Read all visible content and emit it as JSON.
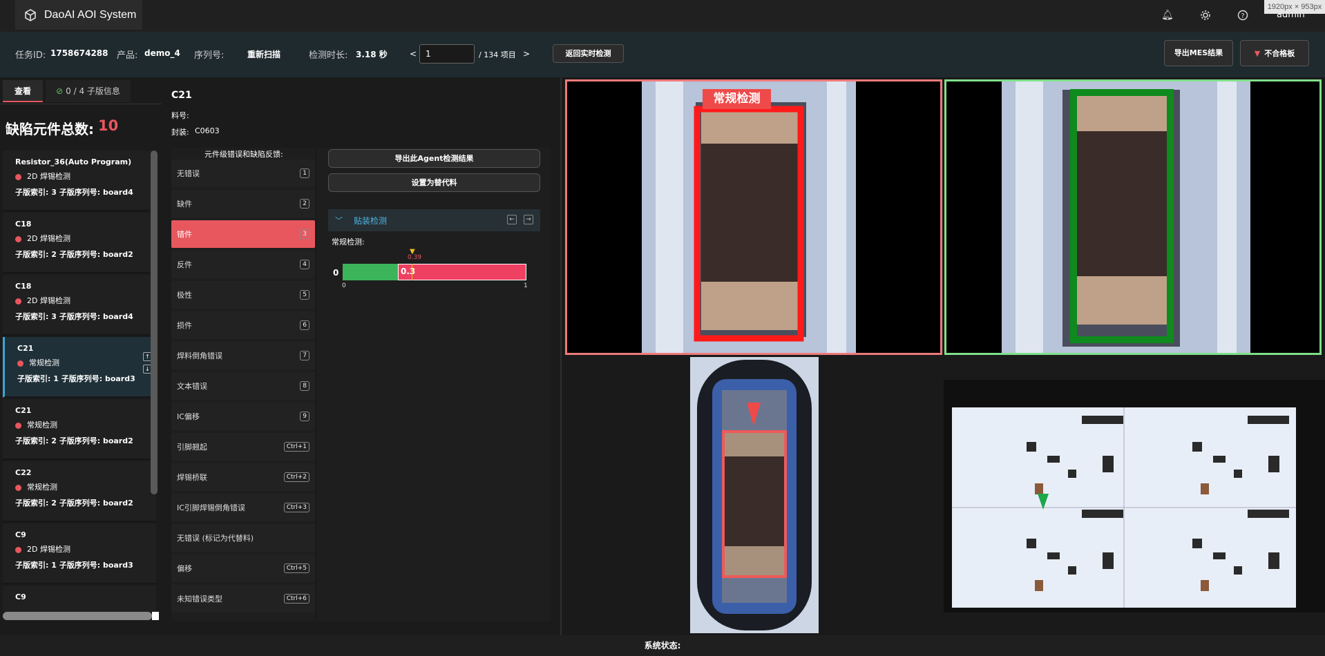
{
  "app": {
    "title": "DaoAI AOI System",
    "user": "admin",
    "screen_dims": "1920px × 953px"
  },
  "info": {
    "task_label": "任务ID:",
    "task_id": "1758674288",
    "product_label": "产品:",
    "product": "demo_4",
    "serial_label": "序列号:",
    "rescan": "重新扫描",
    "duration_label": "检测时长:",
    "duration": "3.18 秒",
    "prev": "<",
    "page_value": "1",
    "page_total": "/ 134 项目",
    "next": ">",
    "back_live": "返回实时检测",
    "export_mes": "导出MES结果",
    "fail_board": "不合格板"
  },
  "left": {
    "tab_view": "查看",
    "tab_sub": "0 / 4  子版信息",
    "defect_label": "缺陷元件总数:",
    "defect_count": "10",
    "items": [
      {
        "name": "Resistor_36(Auto Program)",
        "detect": "2D 焊锡检测",
        "sub": "子版索引: 3   子版序列号: board4"
      },
      {
        "name": "C18",
        "detect": "2D 焊锡检测",
        "sub": "子版索引: 2   子版序列号: board2"
      },
      {
        "name": "C18",
        "detect": "2D 焊锡检测",
        "sub": "子版索引: 3   子版序列号: board4"
      },
      {
        "name": "C21",
        "detect": "常规检测",
        "sub": "子版索引: 1   子版序列号: board3"
      },
      {
        "name": "C21",
        "detect": "常规检测",
        "sub": "子版索引: 2   子版序列号: board2"
      },
      {
        "name": "C22",
        "detect": "常规检测",
        "sub": "子版索引: 2   子版序列号: board2"
      },
      {
        "name": "C9",
        "detect": "2D 焊锡检测",
        "sub": "子版索引: 1   子版序列号: board3"
      },
      {
        "name": "C9",
        "detect": "",
        "sub": ""
      }
    ]
  },
  "mid": {
    "comp": "C21",
    "part_label": "料号:",
    "pkg_label": "封装:",
    "pkg": "C0603",
    "feedback_title": "元件级错误和缺陷反馈:",
    "errors": [
      {
        "label": "无错误",
        "key": "1"
      },
      {
        "label": "缺件",
        "key": "2"
      },
      {
        "label": "错件",
        "key": "3"
      },
      {
        "label": "反件",
        "key": "4"
      },
      {
        "label": "极性",
        "key": "5"
      },
      {
        "label": "损件",
        "key": "6"
      },
      {
        "label": "焊料倒角错误",
        "key": "7"
      },
      {
        "label": "文本错误",
        "key": "8"
      },
      {
        "label": "IC偏移",
        "key": "9"
      },
      {
        "label": "引脚翘起",
        "key": "Ctrl+1"
      },
      {
        "label": "焊锡桥联",
        "key": "Ctrl+2"
      },
      {
        "label": "IC引脚焊锡倒角错误",
        "key": "Ctrl+3"
      },
      {
        "label": "无错误 (标记为代替料)",
        "key": ""
      },
      {
        "label": "偏移",
        "key": "Ctrl+5"
      },
      {
        "label": "未知错误类型",
        "key": "Ctrl+6"
      }
    ],
    "export_agent": "导出此Agent检测结果",
    "set_sub": "设置为替代料",
    "section": "贴装检测",
    "regular_label": "常规检测:",
    "score": {
      "left": "0",
      "value_text": "0.3",
      "threshold": "0.39",
      "min": "0",
      "max": "1"
    }
  },
  "images": {
    "overlay_label": "常规检测"
  },
  "status": {
    "label": "系统状态:"
  }
}
